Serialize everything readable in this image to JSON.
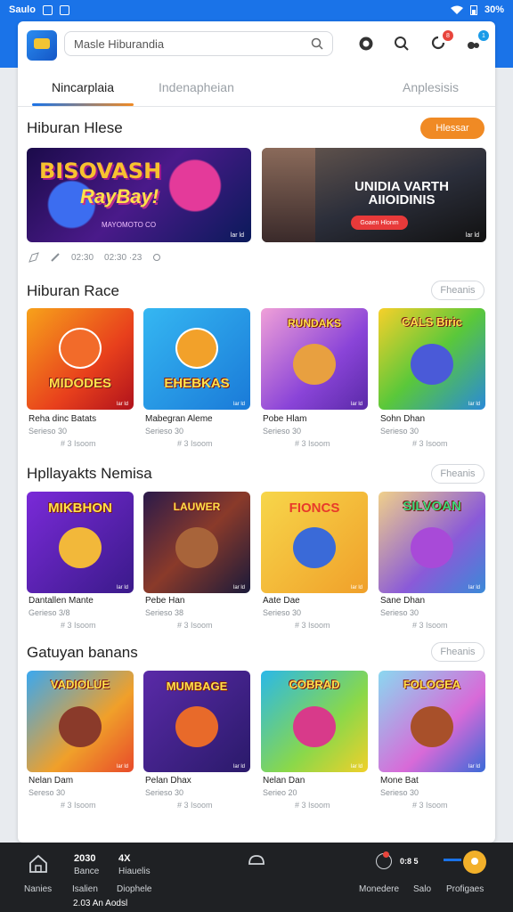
{
  "status_bar": {
    "carrier": "Saulo",
    "right_text": "30%"
  },
  "header": {
    "search_placeholder": "Masle Hiburandia",
    "icons": [
      "logo-icon",
      "search-icon",
      "alert-icon",
      "bell-icon",
      "game-icon"
    ],
    "bell_badge": "8",
    "game_badge": "1"
  },
  "tabs": [
    {
      "label": "Nincarplaia",
      "active": true
    },
    {
      "label": "Indenapheian",
      "active": false
    },
    {
      "label": "Anplesisis",
      "active": false
    }
  ],
  "section_featured": {
    "title": "Hiburan Hlese",
    "button": "Hlessar",
    "banners": [
      {
        "title_line1": "BISOVASH",
        "title_line2": "RayBay!",
        "subtitle": "MAYOMOTO CO",
        "corner": "lar ld"
      },
      {
        "title_line1": "UNIDIA VARTH",
        "title_line2": "AIIOIDINIS",
        "button": "Goaen Hlonm",
        "corner": "lar ld"
      }
    ],
    "meta": [
      "02:30",
      "02:30 ·23"
    ]
  },
  "sections": [
    {
      "title": "Hiburan Race",
      "action": "Fheanis",
      "items": [
        {
          "art": "MIDODES",
          "name": "Reha dinc Batats",
          "sub": "Serieso 30",
          "meta": "# 3 Isoom"
        },
        {
          "art": "EHEBKAS",
          "name": "Mabegran Aleme",
          "sub": "Serieso 30",
          "meta": "# 3 Isoom"
        },
        {
          "art": "RUNDAKS",
          "name": "Pobe Hlam",
          "sub": "Serieso 30",
          "meta": "# 3 Isoom"
        },
        {
          "art": "CALS Biric",
          "name": "Sohn Dhan",
          "sub": "Serieso 30",
          "meta": "# 3 Isoom"
        }
      ]
    },
    {
      "title": "Hpllayakts Nemisa",
      "action": "Fheanis",
      "items": [
        {
          "art": "MIKBHON",
          "name": "Dantallen Mante",
          "sub": "Gerieso 3/8",
          "meta": "# 3 Isoom"
        },
        {
          "art": "LAUWER",
          "name": "Pebe Han",
          "sub": "Serieso 38",
          "meta": "# 3 Isoom"
        },
        {
          "art": "FIONCS",
          "name": "Aate Dae",
          "sub": "Serieso 30",
          "meta": "# 3 Isoom"
        },
        {
          "art": "SILVOAN",
          "name": "Sane Dhan",
          "sub": "Serieso 30",
          "meta": "# 3 Isoom"
        }
      ]
    },
    {
      "title": "Gatuyan banans",
      "action": "Fheanis",
      "items": [
        {
          "art": "VADIOLUE",
          "name": "Nelan Dam",
          "sub": "Sereso 30",
          "meta": "# 3 Isoom"
        },
        {
          "art": "MUMBAGE",
          "name": "Pelan Dhax",
          "sub": "Serieso 30",
          "meta": "# 3 Isoom"
        },
        {
          "art": "COBRAD",
          "name": "Nelan Dan",
          "sub": "Serieo 20",
          "meta": "# 3 Isoom"
        },
        {
          "art": "FOLOGEA",
          "name": "Mone Bat",
          "sub": "Serieso 30",
          "meta": "# 3 Isoom"
        }
      ]
    }
  ],
  "bottom_nav": {
    "home_label": "Nanies",
    "stat1_value": "2030",
    "stat1_label": "Bance",
    "stat1_sub": "Isalien",
    "stat2_value": "4X",
    "stat2_label": "Hiauelis",
    "stat2_sub": "Diophele",
    "footer_text": "2.03 An Aodsl",
    "notif_value": "0:8 5",
    "notif_label": "Monedere",
    "middle_label": "Salo",
    "profile_label": "Profigaes"
  },
  "colors": {
    "primary": "#1a73e8",
    "accent": "#f08a24",
    "nav_bg": "#1f2124"
  }
}
